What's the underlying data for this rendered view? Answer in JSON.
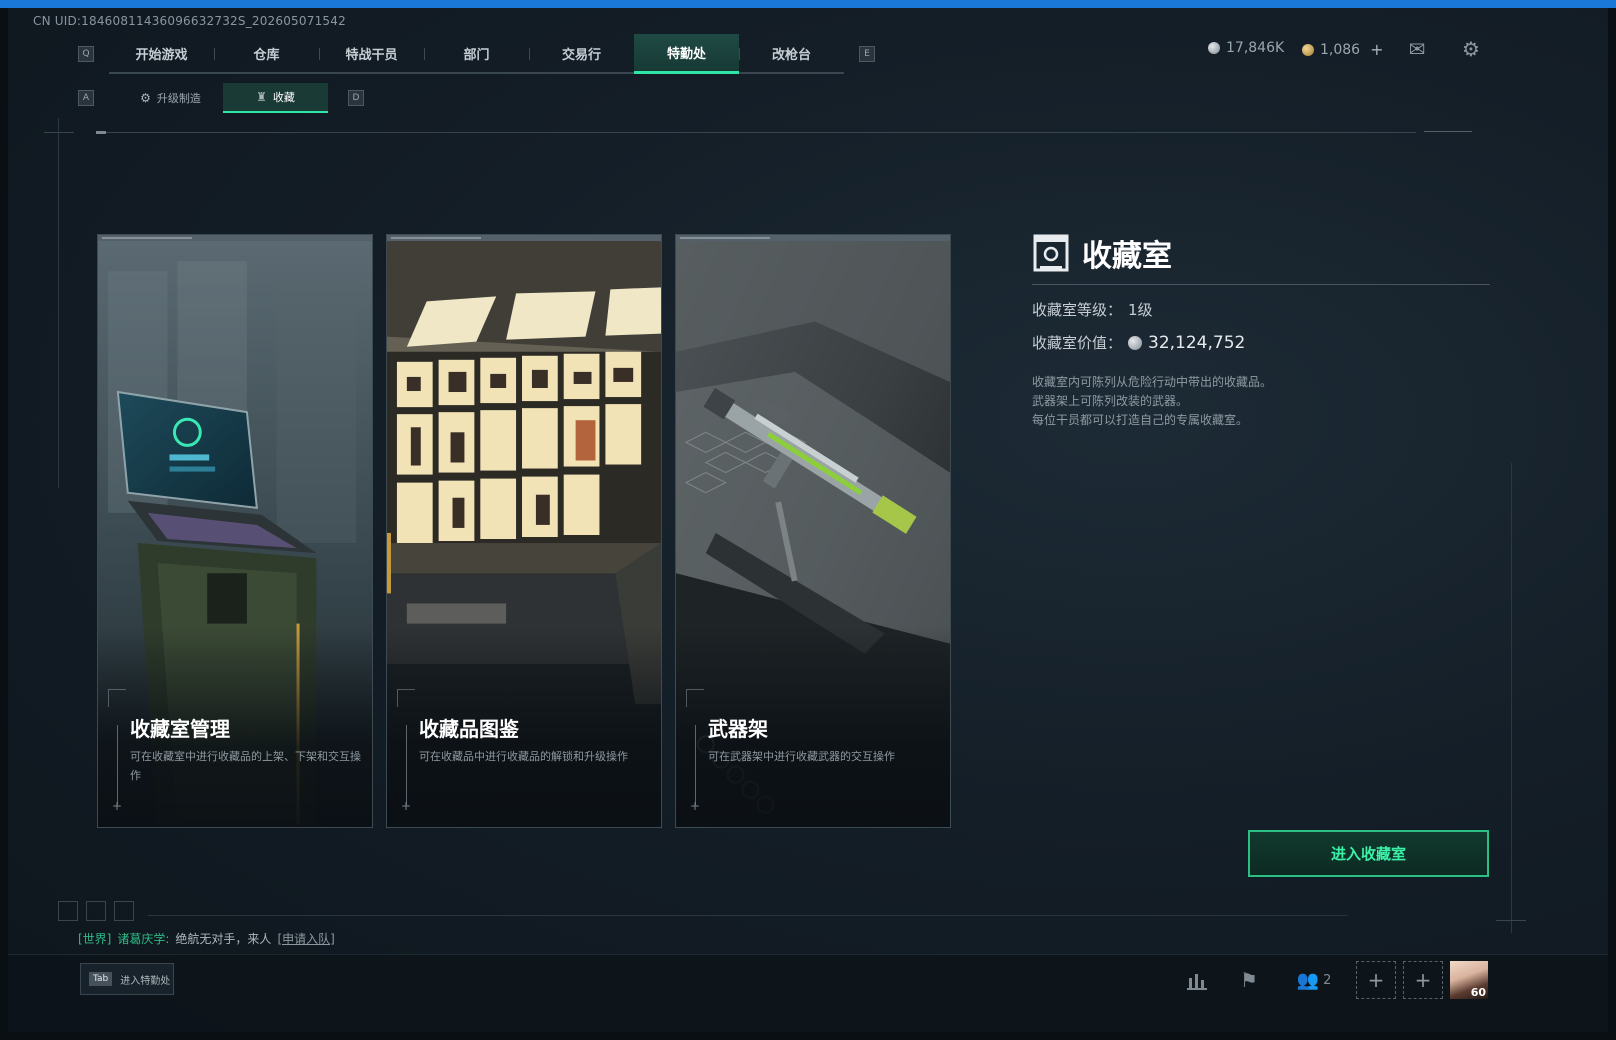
{
  "uid": "CN UID:18460811436096632732S_202605071542",
  "nav": {
    "left_key": "Q",
    "right_key": "E",
    "tabs": [
      "开始游戏",
      "仓库",
      "特战干员",
      "部门",
      "交易行",
      "特勤处",
      "改枪台"
    ],
    "active_tab": "特勤处"
  },
  "subnav": {
    "left_key": "A",
    "right_key": "D",
    "tabs": [
      {
        "label": "升级制造",
        "icon": "wrench-icon"
      },
      {
        "label": "收藏",
        "icon": "trophy-icon"
      }
    ],
    "active_tab": "收藏"
  },
  "currency": {
    "silver": "17,846K",
    "gold": "1,086"
  },
  "cards": [
    {
      "title": "收藏室管理",
      "desc": "可在收藏室中进行收藏品的上架、下架和交互操作"
    },
    {
      "title": "收藏品图鉴",
      "desc": "可在收藏品中进行收藏品的解锁和升级操作"
    },
    {
      "title": "武器架",
      "desc": "可在武器架中进行收藏武器的交互操作"
    }
  ],
  "info": {
    "title": "收藏室",
    "level_label": "收藏室等级：",
    "level_value": "1级",
    "value_label": "收藏室价值：",
    "value": "32,124,752",
    "desc_lines": [
      "收藏室内可陈列从危险行动中带出的收藏品。",
      "武器架上可陈列改装的武器。",
      "每位干员都可以打造自己的专属收藏室。"
    ]
  },
  "enter_button": "进入收藏室",
  "chat": {
    "channel": "[世界]",
    "name": "诸葛庆学:",
    "message": "绝航无对手，来人",
    "link": "[申请入队]"
  },
  "bottom": {
    "tab_key": "Tab",
    "tab_label": "进入特勤处",
    "friends_count": "2",
    "level": "60"
  },
  "colors": {
    "accent": "#2ee6a6",
    "button_border": "#2bbf86",
    "background": "#141e27"
  }
}
